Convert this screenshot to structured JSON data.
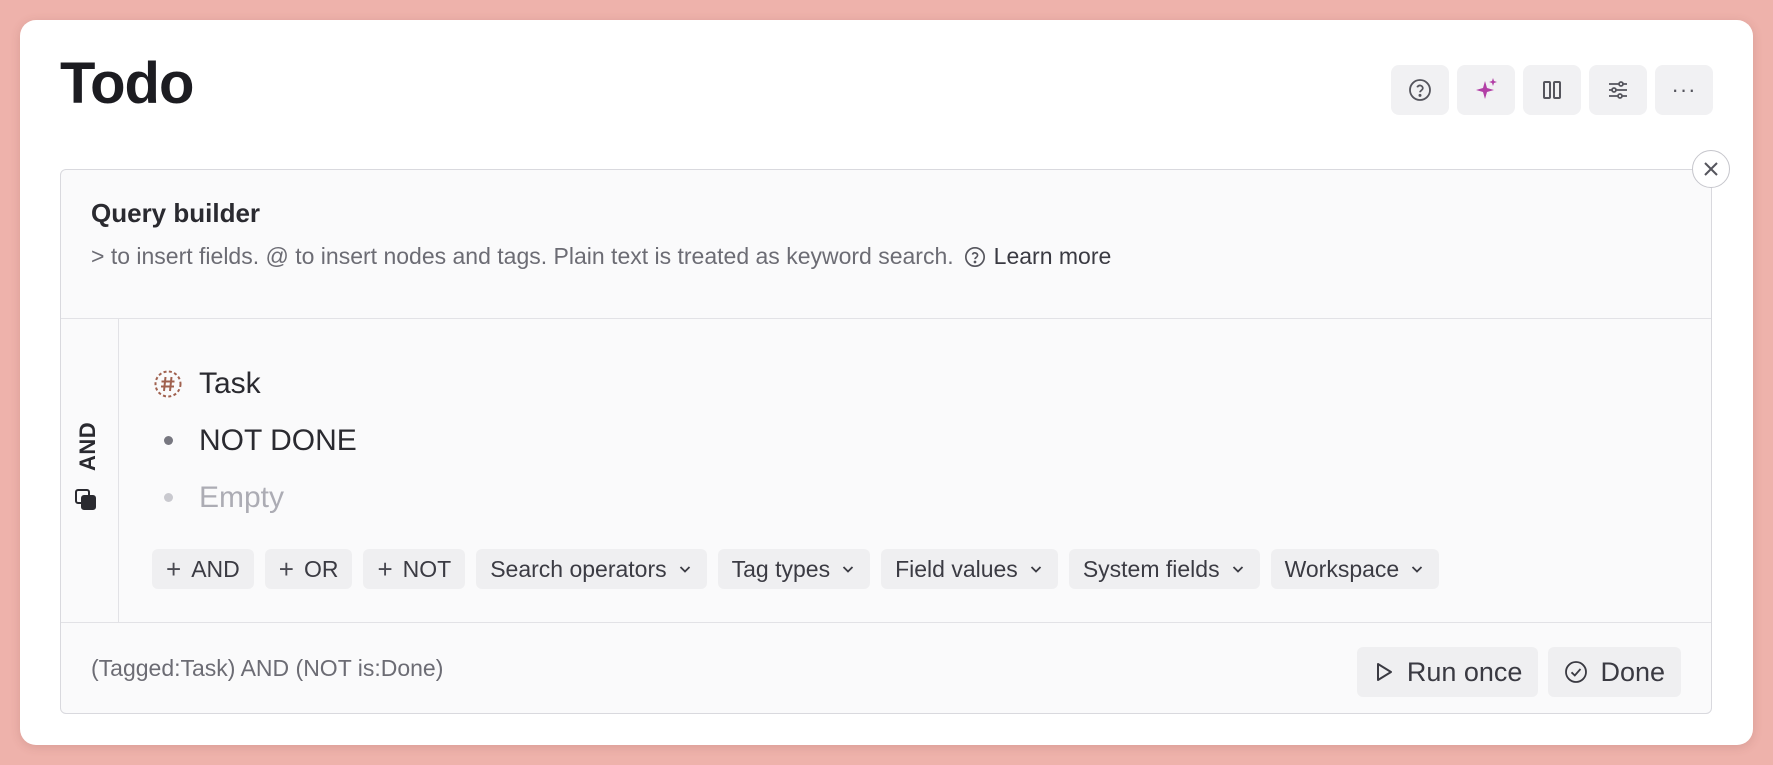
{
  "page": {
    "title": "Todo"
  },
  "toolbar": {
    "buttons": [
      {
        "name": "help",
        "icon": "question-circle-icon"
      },
      {
        "name": "ai",
        "icon": "sparkle-icon",
        "color": "#b23fa6"
      },
      {
        "name": "columns",
        "icon": "columns-icon"
      },
      {
        "name": "settings",
        "icon": "sliders-icon"
      },
      {
        "name": "more",
        "icon": "ellipsis-icon",
        "label": "···"
      }
    ]
  },
  "query_builder": {
    "title": "Query builder",
    "help_text": "> to insert fields. @ to insert nodes and tags. Plain text is treated as keyword search.",
    "learn_more": "Learn more",
    "group_operator": "AND",
    "conditions": [
      {
        "icon": "hash-tag-icon",
        "label": "Task"
      },
      {
        "icon": "bullet-icon",
        "label": "NOT DONE"
      },
      {
        "icon": "bullet-icon",
        "label": "Empty",
        "placeholder": true
      }
    ],
    "add_buttons": [
      "AND",
      "OR",
      "NOT"
    ],
    "dropdowns": [
      "Search operators",
      "Tag types",
      "Field values",
      "System fields",
      "Workspace"
    ],
    "query_string": "(Tagged:Task) AND (NOT is:Done)",
    "run_once_label": "Run once",
    "done_label": "Done"
  },
  "colors": {
    "background": "#eeb2ab",
    "accent_sparkle": "#b23fa6",
    "tag_icon": "#a0614f"
  }
}
